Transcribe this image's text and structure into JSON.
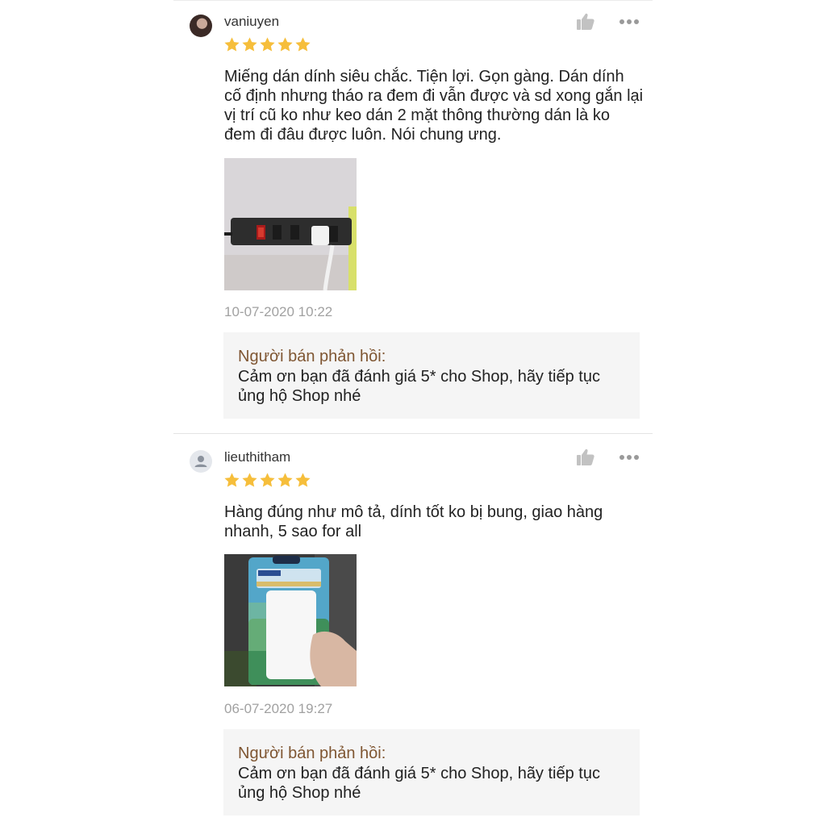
{
  "colors": {
    "star": "#f6be3b",
    "reply_title": "#7f5632",
    "reply_bg": "#f5f5f5",
    "timestamp": "#a1a1a1"
  },
  "icons": {
    "like": "thumbs-up-icon",
    "more": "more-options-icon",
    "star": "star-icon",
    "default_avatar": "user-icon"
  },
  "reviews": [
    {
      "username": "vaniuyen",
      "rating": 5,
      "content": "Miếng dán dính siêu chắc. Tiện lợi. Gọn gàng. Dán dính cố định nhưng tháo ra đem đi vẫn được và sd xong gắn lại vị trí cũ ko như keo dán 2 mặt thông thường dán là ko đem đi đâu được luôn. Nói chung ưng.",
      "timestamp": "10-07-2020 10:22",
      "reply_title": "Người bán phản hồi:",
      "reply_text": "Cảm ơn bạn đã đánh giá 5* cho Shop, hãy tiếp tục ủng hộ Shop nhé"
    },
    {
      "username": "lieuthitham",
      "rating": 5,
      "content": "Hàng đúng như mô tả, dính tốt ko bị bung, giao hàng nhanh, 5 sao for all",
      "timestamp": "06-07-2020 19:27",
      "reply_title": "Người bán phản hồi:",
      "reply_text": "Cảm ơn bạn đã đánh giá 5* cho Shop, hãy tiếp tục ủng hộ Shop nhé"
    }
  ]
}
